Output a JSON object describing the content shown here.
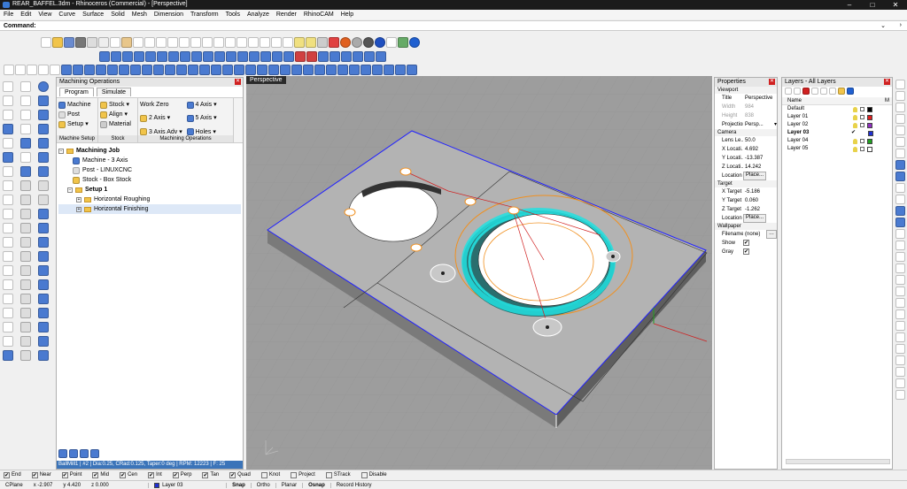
{
  "window": {
    "title": "REAR_BAFFEL.3dm - Rhinoceros (Commercial) - [Perspective]",
    "minimize": "–",
    "maximize": "□",
    "close": "✕"
  },
  "menu": [
    "File",
    "Edit",
    "View",
    "Curve",
    "Surface",
    "Solid",
    "Mesh",
    "Dimension",
    "Transform",
    "Tools",
    "Analyze",
    "Render",
    "RhinoCAM",
    "Help"
  ],
  "command": {
    "label": "Command:",
    "value": ""
  },
  "machining": {
    "title": "Machining Operations",
    "tabs": [
      "Program",
      "Simulate"
    ],
    "ribbon": {
      "machine_setup": {
        "items": [
          "Machine",
          "Post",
          "Setup ▾"
        ],
        "name": "Machine Setup"
      },
      "stock": {
        "items": [
          "Stock ▾",
          "Align ▾",
          "Material"
        ],
        "name": "Stock"
      },
      "ops": {
        "items": [
          "Work Zero",
          "2 Axis ▾",
          "3 Axis Adv ▾",
          "4 Axis ▾",
          "5 Axis ▾",
          "Holes ▾"
        ],
        "name": "Machining Operations"
      }
    },
    "tree": {
      "root": "Machining Job",
      "machine": "Machine - 3 Axis",
      "post": "Post - LINUXCNC",
      "stock": "Stock - Box Stock",
      "setup": "Setup 1",
      "ops": [
        "Horizontal Roughing",
        "Horizontal Finishing"
      ]
    },
    "status": "BallMill1 | #2 | Dia:0.25, CRad:0.125, Taper:0 deg | RPM: 12223 | F: 25"
  },
  "viewport": {
    "name": "Perspective"
  },
  "properties": {
    "title": "Properties",
    "viewport_section": "Viewport",
    "title_label": "Title",
    "title_value": "Perspective",
    "width_label": "Width",
    "width_value": "984",
    "height_label": "Height",
    "height_value": "838",
    "projection_label": "Projection",
    "projection_value": "Persp...",
    "camera_section": "Camera",
    "lens_label": "Lens Le...",
    "lens_value": "50.0",
    "xloc_label": "X Locati...",
    "xloc_value": "4.692",
    "yloc_label": "Y Locati...",
    "yloc_value": "-13.387",
    "zloc_label": "Z Locati...",
    "zloc_value": "14.242",
    "location_label": "Location",
    "place_button": "Place...",
    "target_section": "Target",
    "xt_label": "X Target",
    "xt_value": "-5.186",
    "yt_label": "Y Target",
    "yt_value": "0.060",
    "zt_label": "Z Target",
    "zt_value": "-1.262",
    "tlocation_label": "Location",
    "tplace_button": "Place...",
    "wallpaper_section": "Wallpaper",
    "filename_label": "Filename",
    "filename_value": "(none)",
    "show_label": "Show",
    "gray_label": "Gray"
  },
  "layers": {
    "title": "Layers - All Layers",
    "name_header": "Name",
    "m_header": "M",
    "rows": [
      {
        "name": "Default",
        "color": "#000000",
        "current": false
      },
      {
        "name": "Layer 01",
        "color": "#e02020",
        "current": false
      },
      {
        "name": "Layer 02",
        "color": "#9030c0",
        "current": false
      },
      {
        "name": "Layer 03",
        "color": "#2030d0",
        "current": true
      },
      {
        "name": "Layer 04",
        "color": "#20a020",
        "current": false
      },
      {
        "name": "Layer 05",
        "color": "#ffffff",
        "current": false
      }
    ],
    "check": "✔"
  },
  "osnap": [
    "End",
    "Near",
    "Point",
    "Mid",
    "Cen",
    "Int",
    "Perp",
    "Tan",
    "Quad",
    "Knot",
    "Project",
    "STrack",
    "Disable"
  ],
  "osnap_checked": [
    true,
    true,
    true,
    true,
    true,
    true,
    true,
    true,
    true,
    false,
    false,
    false,
    false
  ],
  "status": {
    "cplane": "CPlane",
    "x": "x -2.907",
    "y": "y 4.420",
    "z": "z 0.000",
    "layer": "Layer 03",
    "snap": "Snap",
    "ortho": "Ortho",
    "planar": "Planar",
    "osnap": "Osnap",
    "record": "Record History"
  },
  "colors": {
    "viewport_bg": "#9d9d9d",
    "plate_top": "#b3b3b3",
    "plate_side": "#6e6e6e",
    "selection_blue": "#2020ff",
    "toolpath_cyan": "#22e0e0",
    "orange": "#f09020",
    "red": "#d02020"
  }
}
